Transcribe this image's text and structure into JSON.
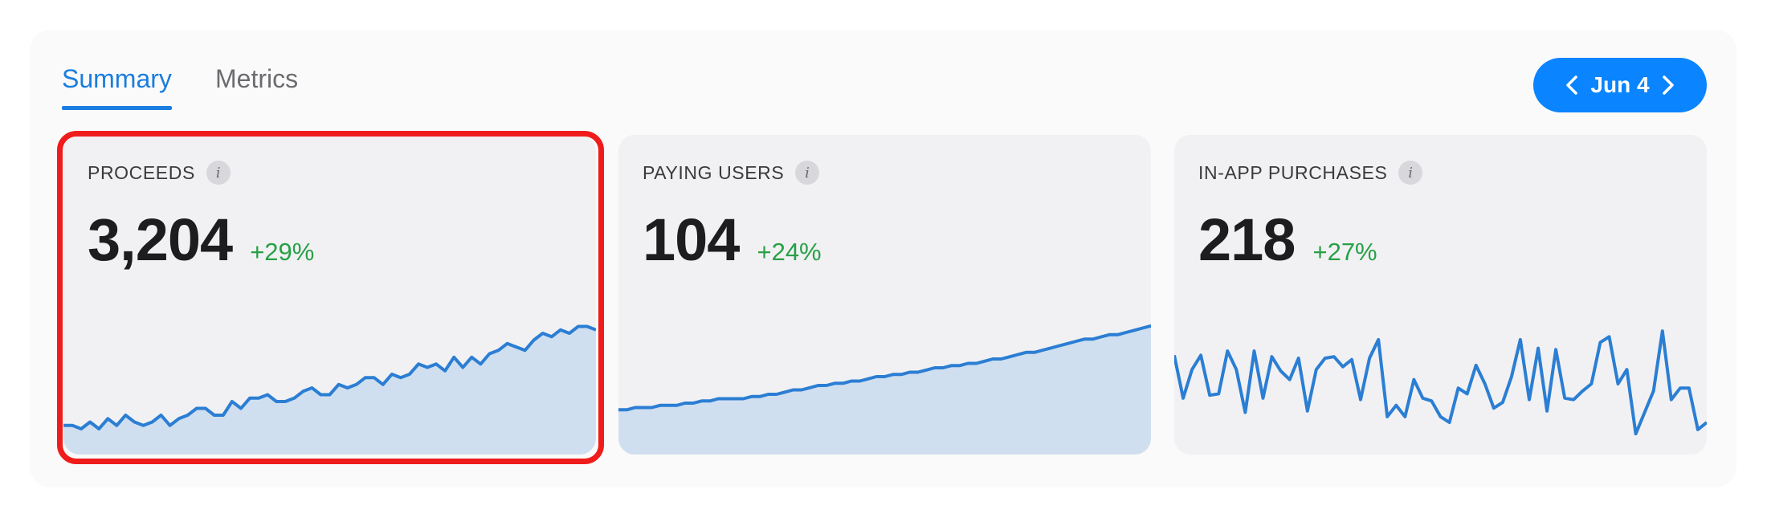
{
  "tabs": {
    "summary": "Summary",
    "metrics": "Metrics"
  },
  "date_nav": {
    "label": "Jun 4",
    "prev_icon": "chevron-left-icon",
    "next_icon": "chevron-right-icon"
  },
  "colors": {
    "accent": "#0a84ff",
    "tab_active": "#1a7de0",
    "positive": "#27a046",
    "line": "#2b7ed3",
    "area": "#cfdff0",
    "highlight": "#f01c1c"
  },
  "cards": [
    {
      "title": "PROCEEDS",
      "info_icon": "info-icon",
      "value": "3,204",
      "change": "+29%",
      "sparkline": [
        34,
        34,
        33,
        35,
        33,
        36,
        34,
        37,
        35,
        34,
        35,
        37,
        34,
        36,
        37,
        39,
        39,
        37,
        37,
        41,
        39,
        42,
        42,
        43,
        41,
        41,
        42,
        44,
        45,
        43,
        43,
        46,
        45,
        46,
        48,
        48,
        46,
        49,
        48,
        49,
        52,
        51,
        52,
        50,
        54,
        51,
        54,
        52,
        55,
        56,
        58,
        57,
        56,
        59,
        61,
        60,
        62,
        61,
        63,
        63,
        62
      ],
      "sparkline_range": [
        25,
        65
      ]
    },
    {
      "title": "PAYING USERS",
      "info_icon": "info-icon",
      "value": "104",
      "change": "+24%",
      "sparkline": [
        41,
        41,
        42,
        42,
        42,
        43,
        43,
        43,
        44,
        44,
        45,
        45,
        46,
        46,
        46,
        46,
        47,
        47,
        48,
        48,
        49,
        50,
        50,
        51,
        52,
        52,
        53,
        53,
        54,
        54,
        55,
        56,
        56,
        57,
        57,
        58,
        58,
        59,
        60,
        60,
        61,
        61,
        62,
        62,
        63,
        64,
        64,
        65,
        66,
        67,
        67,
        68,
        69,
        70,
        71,
        72,
        73,
        73,
        74,
        75,
        75,
        76,
        77,
        78,
        79
      ],
      "sparkline_range": [
        20,
        100
      ]
    },
    {
      "title": "IN-APP PURCHASES",
      "info_icon": "info-icon",
      "value": "218",
      "change": "+27%",
      "sparkline": [
        6.5,
        3.5,
        5.5,
        6.5,
        3.7,
        3.8,
        6.8,
        5.5,
        2.5,
        6.8,
        3.5,
        6.4,
        5.4,
        4.8,
        6.3,
        2.6,
        5.5,
        6.3,
        6.4,
        5.7,
        6.2,
        3.4,
        6.3,
        7.6,
        2.2,
        3.0,
        2.2,
        4.8,
        3.5,
        3.3,
        2.2,
        1.8,
        4.2,
        3.8,
        5.8,
        4.5,
        2.8,
        3.2,
        5.0,
        7.6,
        3.4,
        7.0,
        2.6,
        6.9,
        3.5,
        3.4,
        4.0,
        4.5,
        7.4,
        7.8,
        4.5,
        5.5,
        1.0,
        2.5,
        4.0,
        8.2,
        3.4,
        4.2,
        4.2,
        1.3,
        1.8
      ],
      "sparkline_range": [
        0,
        9
      ]
    }
  ]
}
